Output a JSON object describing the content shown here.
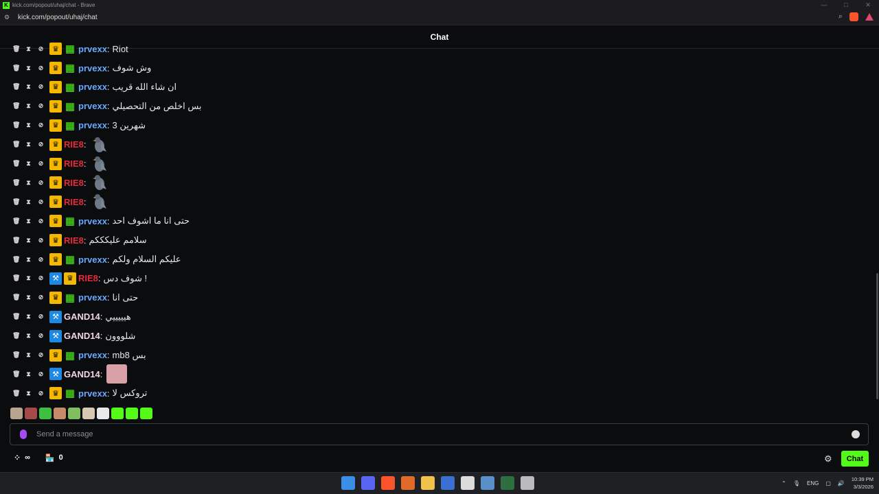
{
  "window": {
    "title": "kick.com/popout/uhaj/chat - Brave",
    "controls": [
      "—",
      "□",
      "✕"
    ]
  },
  "urlbar": {
    "url": "kick.com/popout/uhaj/chat"
  },
  "chat": {
    "header": "Chat",
    "partial_top": {
      "user": "prvexx",
      "text": "Riot"
    },
    "messages": [
      {
        "user": "prvexx",
        "color": "blue",
        "badges": [
          "crown",
          "gift"
        ],
        "text": "وش شوف"
      },
      {
        "user": "prvexx",
        "color": "blue",
        "badges": [
          "crown",
          "gift"
        ],
        "text": "ان شاء الله قريب"
      },
      {
        "user": "prvexx",
        "color": "blue",
        "badges": [
          "crown",
          "gift"
        ],
        "text": "بس اخلص من التحصيلي"
      },
      {
        "user": "prvexx",
        "color": "blue",
        "badges": [
          "crown",
          "gift"
        ],
        "text": "شهرين 3"
      },
      {
        "user": "RIE8",
        "color": "red",
        "badges": [
          "crown"
        ],
        "text": "",
        "emote": "pigeon"
      },
      {
        "user": "RIE8",
        "color": "red",
        "badges": [
          "crown"
        ],
        "text": "",
        "emote": "pigeon"
      },
      {
        "user": "RIE8",
        "color": "red",
        "badges": [
          "crown"
        ],
        "text": "",
        "emote": "pigeon"
      },
      {
        "user": "RIE8",
        "color": "red",
        "badges": [
          "crown"
        ],
        "text": "",
        "emote": "pigeon"
      },
      {
        "user": "prvexx",
        "color": "blue",
        "badges": [
          "crown",
          "gift"
        ],
        "text": "حتى انا ما اشوف احد"
      },
      {
        "user": "RIE8",
        "color": "red",
        "badges": [
          "crown"
        ],
        "text": "سلامم عليكككم"
      },
      {
        "user": "prvexx",
        "color": "blue",
        "badges": [
          "crown",
          "gift"
        ],
        "text": "عليكم السلام ولكم"
      },
      {
        "user": "RIE8",
        "color": "red",
        "badges": [
          "hammer",
          "crown"
        ],
        "text": "! شوف دس"
      },
      {
        "user": "prvexx",
        "color": "blue",
        "badges": [
          "crown",
          "gift"
        ],
        "text": "حتى انا"
      },
      {
        "user": "GAND14",
        "color": "pink",
        "badges": [
          "hammer"
        ],
        "text": "هيييييي"
      },
      {
        "user": "GAND14",
        "color": "pink",
        "badges": [
          "hammer"
        ],
        "text": "شلووون"
      },
      {
        "user": "prvexx",
        "color": "blue",
        "badges": [
          "crown",
          "gift"
        ],
        "text": "بس mb8"
      },
      {
        "user": "GAND14",
        "color": "pink",
        "badges": [
          "hammer"
        ],
        "text": "",
        "emote": "face"
      },
      {
        "user": "prvexx",
        "color": "blue",
        "badges": [
          "crown",
          "gift"
        ],
        "text": "تروكس لا"
      }
    ],
    "mod_icons": [
      "trash-icon",
      "timeout-icon",
      "ban-icon"
    ],
    "emote_bar_colors": [
      "#b9a58f",
      "#a44a4a",
      "#3fbf3f",
      "#c78a6a",
      "#7fbf5f",
      "#d8c8b0",
      "#e8e8e8",
      "#53fc18",
      "#53fc18",
      "#53fc18"
    ],
    "input": {
      "placeholder": "Send a message"
    },
    "bottom": {
      "points_value": "∞",
      "store_count": "0",
      "send_label": "Chat"
    }
  },
  "colors": {
    "accent": "#53fc18",
    "crown": "#f5b800",
    "blue_user": "#6aa8ff",
    "red_user": "#e62a3b",
    "pink_user": "#f2d4e4"
  },
  "taskbar": {
    "icons": [
      "windows-icon",
      "discord-icon",
      "brave-icon",
      "affinity-icon",
      "files-icon",
      "app-icon",
      "obs-icon",
      "steam-icon",
      "excel-icon",
      "clock-icon"
    ],
    "tray_lang": "ENG",
    "time": "10:39 PM",
    "date": "3/3/2026"
  }
}
